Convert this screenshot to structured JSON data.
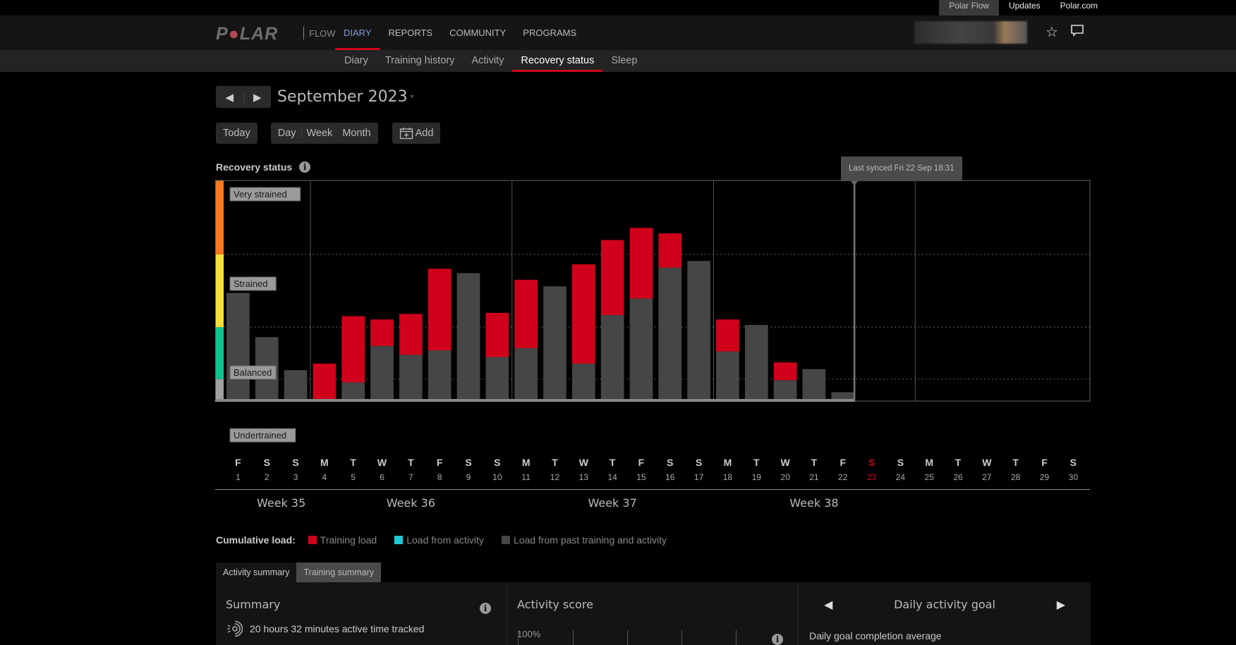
{
  "top_links": [
    {
      "label": "Polar Flow",
      "active": true
    },
    {
      "label": "Updates",
      "active": false
    },
    {
      "label": "Polar.com",
      "active": false
    }
  ],
  "brand": {
    "logo_text": "POLAR",
    "product": "FLOW"
  },
  "main_nav": [
    {
      "label": "DIARY",
      "active": true
    },
    {
      "label": "REPORTS",
      "active": false
    },
    {
      "label": "COMMUNITY",
      "active": false
    },
    {
      "label": "PROGRAMS",
      "active": false
    }
  ],
  "header_icons": {
    "favorites": "star-icon",
    "messages": "message-icon"
  },
  "sub_nav": [
    {
      "label": "Diary",
      "active": false
    },
    {
      "label": "Training history",
      "active": false
    },
    {
      "label": "Activity",
      "active": false
    },
    {
      "label": "Recovery status",
      "active": true
    },
    {
      "label": "Sleep",
      "active": false
    }
  ],
  "date_nav": {
    "prev": "◀",
    "next": "▶",
    "title": "September 2023",
    "caret": "▾"
  },
  "view_controls": {
    "today": "Today",
    "day": "Day",
    "week": "Week",
    "month": "Month",
    "add": "Add"
  },
  "section": {
    "title": "Recovery status"
  },
  "sync": {
    "text": "Last synced Fri 22 Sep 18:31",
    "day": 22
  },
  "colors": {
    "training_load": "#d0021b",
    "activity_load": "#1ec8d8",
    "past_load": "#464646",
    "very_strained": "#f47920",
    "strained": "#f5e03c",
    "balanced": "#10c08e",
    "undertrained": "#a0a0a0",
    "today_red": "#d0021b"
  },
  "chart_data": {
    "type": "bar",
    "stacked": true,
    "title": "Recovery status",
    "xlabel": "",
    "ylabel": "",
    "ylim": [
      0,
      100
    ],
    "zones": [
      {
        "label": "Undertrained",
        "from": 0,
        "to": 10
      },
      {
        "label": "Balanced",
        "from": 10,
        "to": 33.5
      },
      {
        "label": "Strained",
        "from": 33.5,
        "to": 66.5
      },
      {
        "label": "Very strained",
        "from": 66.5,
        "to": 100
      }
    ],
    "categories": [
      "1",
      "2",
      "3",
      "4",
      "5",
      "6",
      "7",
      "8",
      "9",
      "10",
      "11",
      "12",
      "13",
      "14",
      "15",
      "16",
      "17",
      "18",
      "19",
      "20",
      "21",
      "22",
      "23",
      "24",
      "25",
      "26",
      "27",
      "28",
      "29",
      "30"
    ],
    "weekdays": [
      "F",
      "S",
      "S",
      "M",
      "T",
      "W",
      "T",
      "F",
      "S",
      "S",
      "M",
      "T",
      "W",
      "T",
      "F",
      "S",
      "S",
      "M",
      "T",
      "W",
      "T",
      "F",
      "S",
      "S",
      "M",
      "T",
      "W",
      "T",
      "F",
      "S"
    ],
    "today_index": 22,
    "series": [
      {
        "name": "Load from past training and activity",
        "values": [
          49,
          29,
          14,
          0,
          8.5,
          25,
          21,
          23,
          58,
          20,
          24,
          52,
          17,
          39,
          46.5,
          60.5,
          63.5,
          22.5,
          34.5,
          9.5,
          14.5,
          4,
          null,
          null,
          null,
          null,
          null,
          null,
          null,
          null
        ]
      },
      {
        "name": "Training load",
        "values": [
          0,
          0,
          0,
          17,
          30,
          12,
          18.5,
          37,
          0,
          20,
          31,
          0,
          45,
          34,
          32,
          15.5,
          0,
          14.5,
          0,
          8,
          0,
          0,
          null,
          null,
          null,
          null,
          null,
          null,
          null,
          null
        ]
      },
      {
        "name": "Load from activity",
        "values": [
          0,
          0,
          0,
          0,
          0,
          0,
          0,
          0,
          0,
          0,
          0,
          0,
          0,
          0,
          0,
          0,
          0,
          0,
          0,
          0,
          0,
          0,
          null,
          null,
          null,
          null,
          null,
          null,
          null,
          null
        ]
      }
    ],
    "weeks": [
      {
        "label": "Week 35",
        "days": [
          1,
          3
        ]
      },
      {
        "label": "Week 36",
        "days": [
          4,
          10
        ]
      },
      {
        "label": "Week 37",
        "days": [
          11,
          17
        ]
      },
      {
        "label": "Week 38",
        "days": [
          18,
          24
        ]
      }
    ],
    "week_separators_after_day": [
      3,
      10,
      17,
      24
    ],
    "legend": {
      "title": "Cumulative load:",
      "position": "bottom-left"
    }
  },
  "legend": {
    "title": "Cumulative load:",
    "items": [
      {
        "label": "Training load",
        "color": "#d0021b"
      },
      {
        "label": "Load from activity",
        "color": "#1ec8d8"
      },
      {
        "label": "Load from past training and activity",
        "color": "#464646"
      }
    ]
  },
  "tabs": [
    {
      "label": "Activity summary",
      "active": true
    },
    {
      "label": "Training summary",
      "active": false
    }
  ],
  "summary": {
    "title": "Summary",
    "active_time": "20 hours 32 minutes active time tracked"
  },
  "activity_score": {
    "title": "Activity score",
    "axis_top": "100%"
  },
  "daily_goal": {
    "prev": "◀",
    "next": "▶",
    "title": "Daily activity goal",
    "subtitle": "Daily goal completion average"
  }
}
